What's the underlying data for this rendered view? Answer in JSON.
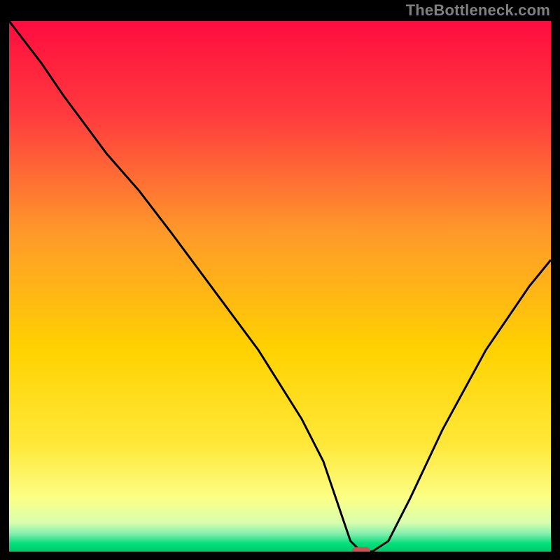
{
  "attribution": "TheBottleneck.com",
  "colors": {
    "frame": "#000000",
    "top": "#ff0c3f",
    "mid": "#ffd200",
    "low1": "#ffff66",
    "low2": "#c8ff8c",
    "bottom": "#00e07a",
    "curve": "#000000",
    "marker": "#cf5353",
    "attribution": "#808080"
  },
  "chart_data": {
    "type": "line",
    "title": "",
    "xlabel": "",
    "ylabel": "",
    "xlim": [
      0,
      100
    ],
    "ylim": [
      0,
      100
    ],
    "axes_visible": false,
    "grid": false,
    "legend": false,
    "series": [
      {
        "name": "curve",
        "x": [
          0,
          6,
          10,
          18,
          24,
          30,
          38,
          46,
          54,
          58,
          61,
          63,
          65,
          67,
          70,
          74,
          80,
          88,
          96,
          100
        ],
        "y": [
          100,
          92,
          86,
          75,
          68,
          60,
          49,
          38,
          25,
          17,
          8,
          2,
          0,
          0,
          2,
          10,
          23,
          38,
          50,
          55
        ]
      }
    ],
    "marker": {
      "x": 65,
      "y": 0,
      "shape": "rounded-rect"
    },
    "background_gradient_stops": [
      {
        "pos": 0.0,
        "color": "#ff0c3f"
      },
      {
        "pos": 0.18,
        "color": "#ff3c3e"
      },
      {
        "pos": 0.4,
        "color": "#ff9a2a"
      },
      {
        "pos": 0.62,
        "color": "#ffd200"
      },
      {
        "pos": 0.8,
        "color": "#ffe83a"
      },
      {
        "pos": 0.9,
        "color": "#fbff86"
      },
      {
        "pos": 0.945,
        "color": "#d8ffae"
      },
      {
        "pos": 0.965,
        "color": "#88f0b0"
      },
      {
        "pos": 0.985,
        "color": "#00e07a"
      },
      {
        "pos": 1.0,
        "color": "#00c86e"
      }
    ]
  }
}
